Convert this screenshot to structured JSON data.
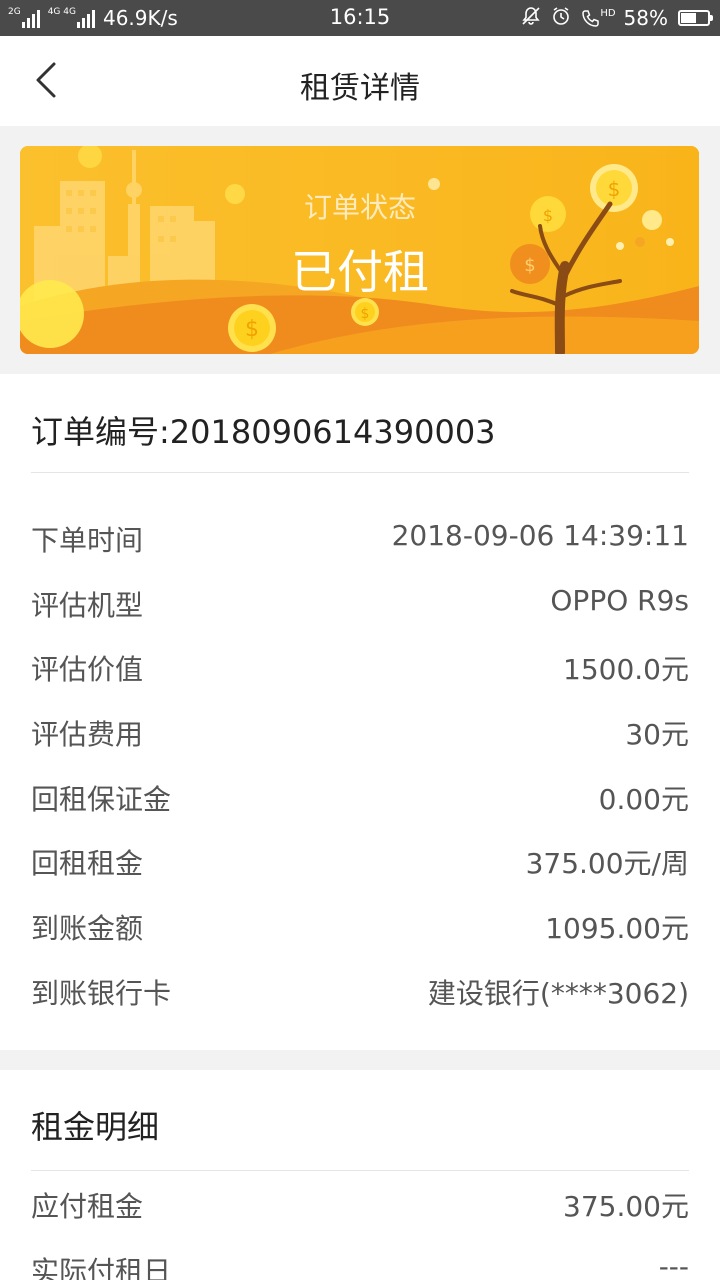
{
  "status_bar": {
    "signal1_tag": "2G",
    "signal2_tag": "4G 4G",
    "net_speed": "46.9K/s",
    "time": "16:15",
    "hd_label": "HD",
    "battery": "58%",
    "battery_level": 0.58
  },
  "navbar": {
    "title": "租赁详情"
  },
  "banner": {
    "label": "订单状态",
    "status": "已付租",
    "colors": {
      "bg": "#f9b81a",
      "hill": "#f08c1e"
    }
  },
  "order": {
    "number_line": "订单编号:2018090614390003",
    "rows": [
      {
        "key": "下单时间",
        "value": "2018-09-06 14:39:11"
      },
      {
        "key": "评估机型",
        "value": "OPPO R9s"
      },
      {
        "key": "评估价值",
        "value": "1500.0元"
      },
      {
        "key": "评估费用",
        "value": "30元"
      },
      {
        "key": "回租保证金",
        "value": "0.00元"
      },
      {
        "key": "回租租金",
        "value": "375.00元/周"
      },
      {
        "key": "到账金额",
        "value": "1095.00元"
      },
      {
        "key": "到账银行卡",
        "value": "建设银行(****3062)"
      }
    ]
  },
  "rent_detail": {
    "title": "租金明细",
    "rows": [
      {
        "key": "应付租金",
        "value": "375.00元"
      },
      {
        "key": "实际付租日",
        "value": "---"
      }
    ]
  }
}
